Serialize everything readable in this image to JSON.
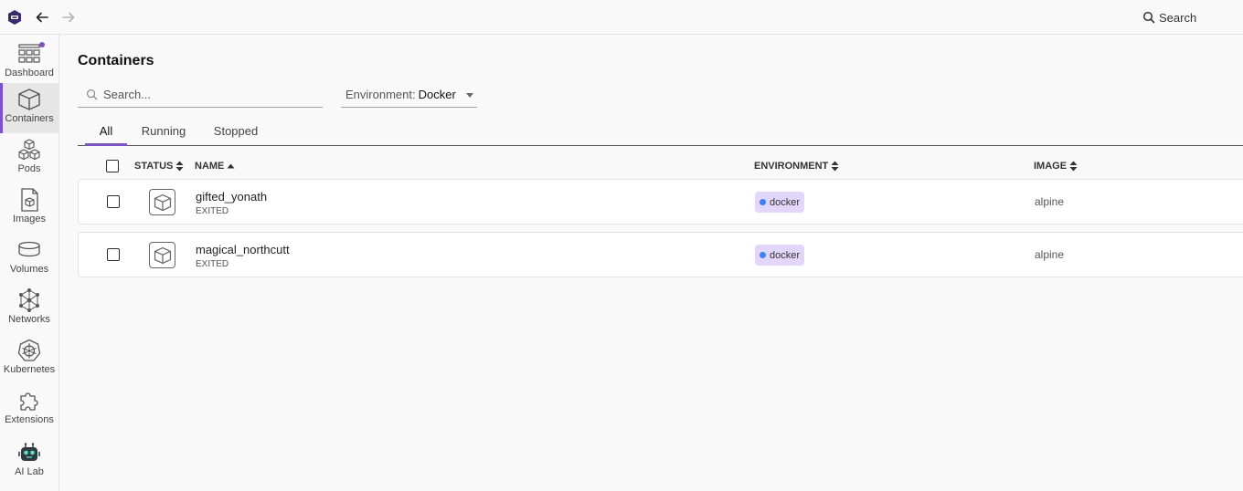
{
  "titlebar": {
    "search_label": "Search"
  },
  "sidebar": {
    "items": [
      {
        "label": "Dashboard"
      },
      {
        "label": "Containers"
      },
      {
        "label": "Pods"
      },
      {
        "label": "Images"
      },
      {
        "label": "Volumes"
      },
      {
        "label": "Networks"
      },
      {
        "label": "Kubernetes"
      },
      {
        "label": "Extensions"
      },
      {
        "label": "AI Lab"
      }
    ]
  },
  "main": {
    "title": "Containers",
    "search_placeholder": "Search...",
    "environment": {
      "label": "Environment:",
      "value": "Docker"
    },
    "tabs": [
      {
        "label": "All"
      },
      {
        "label": "Running"
      },
      {
        "label": "Stopped"
      }
    ],
    "columns": {
      "status": "STATUS",
      "name": "NAME",
      "environment": "ENVIRONMENT",
      "image": "IMAGE"
    },
    "rows": [
      {
        "name": "gifted_yonath",
        "state": "EXITED",
        "environment": "docker",
        "image": "alpine"
      },
      {
        "name": "magical_northcutt",
        "state": "EXITED",
        "environment": "docker",
        "image": "alpine"
      }
    ]
  },
  "colors": {
    "accent": "#7c53c3",
    "env_badge_bg": "#e2d6fb",
    "env_dot": "#3b82f6"
  }
}
